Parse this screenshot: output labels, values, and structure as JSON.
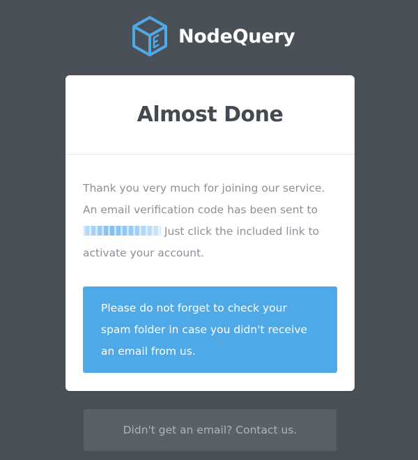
{
  "brand": {
    "name": "NodeQuery",
    "logo_icon": "nodequery-cube-logo-icon",
    "accent_color": "#4ea9e6"
  },
  "card": {
    "title": "Almost Done",
    "message_part1": "Thank you very much for joining our service. An email verification code has been sent to",
    "redacted_email": "[redacted email address]",
    "message_part2": "Just click the included link to activate your account.",
    "notice": "Please do not forget to check your spam folder in case you didn't receive an email from us."
  },
  "footer": {
    "contact_label": "Didn't get an email? Contact us."
  }
}
